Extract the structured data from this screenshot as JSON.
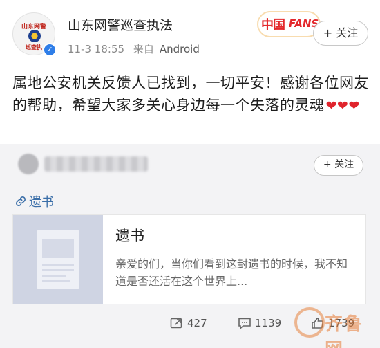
{
  "post": {
    "author": {
      "name": "山东网警巡查执法",
      "avatar_text_top": "山东网警",
      "avatar_text_bottom": "巡查执"
    },
    "time": "11-3 18:55",
    "source_prefix": "来自",
    "source": "Android",
    "badge": {
      "cn": "中国",
      "en": "FANS"
    },
    "follow_label": "+ 关注",
    "content": "属地公安机关反馈人已找到，一切平安！感谢各位网友的帮助，希望大家多关心身边每一个失落的灵魂",
    "hearts": "❤❤❤"
  },
  "repost": {
    "follow_label": "+ 关注",
    "link_label": "遗书",
    "card": {
      "title": "遗书",
      "description": "亲爱的们，当你们看到这封遗书的时候，我不知道是否还活在这个世界上..."
    },
    "actions": {
      "repost_count": "427",
      "comment_count": "1139",
      "like_count": "1739"
    }
  },
  "watermark": "齐鲁网",
  "colors": {
    "link": "#3a6ea8",
    "heart": "#e0242c",
    "verify": "#2f7ee8",
    "badge": "#e3282c",
    "repost_bg": "#f3f3f5"
  }
}
